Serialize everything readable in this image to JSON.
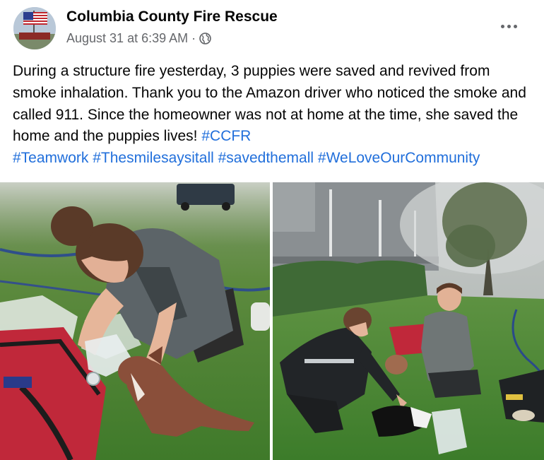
{
  "post": {
    "page_name": "Columbia County Fire Rescue",
    "timestamp": "August 31 at 6:39 AM",
    "separator": "·",
    "audience_icon": "globe-icon",
    "more_icon": "more-options-icon",
    "body": {
      "text": "During a structure fire yesterday, 3 puppies were saved and revived from smoke inhalation. Thank you to the Amazon driver who noticed the smoke and called 911. Since the homeowner was not at home at the time, she saved the home and the puppies lives! ",
      "hashtags": [
        "#CCFR",
        "#Teamwork",
        "#Thesmilesaysitall",
        "#savedthemall",
        "#WeLoveOurCommunity"
      ]
    },
    "photos": [
      {
        "name": "photo-firefighter-puppy-oxygen"
      },
      {
        "name": "photo-firefighters-puppies-lawn"
      }
    ]
  },
  "colors": {
    "text": "#050505",
    "secondary": "#65676b",
    "link": "#216fdb"
  }
}
